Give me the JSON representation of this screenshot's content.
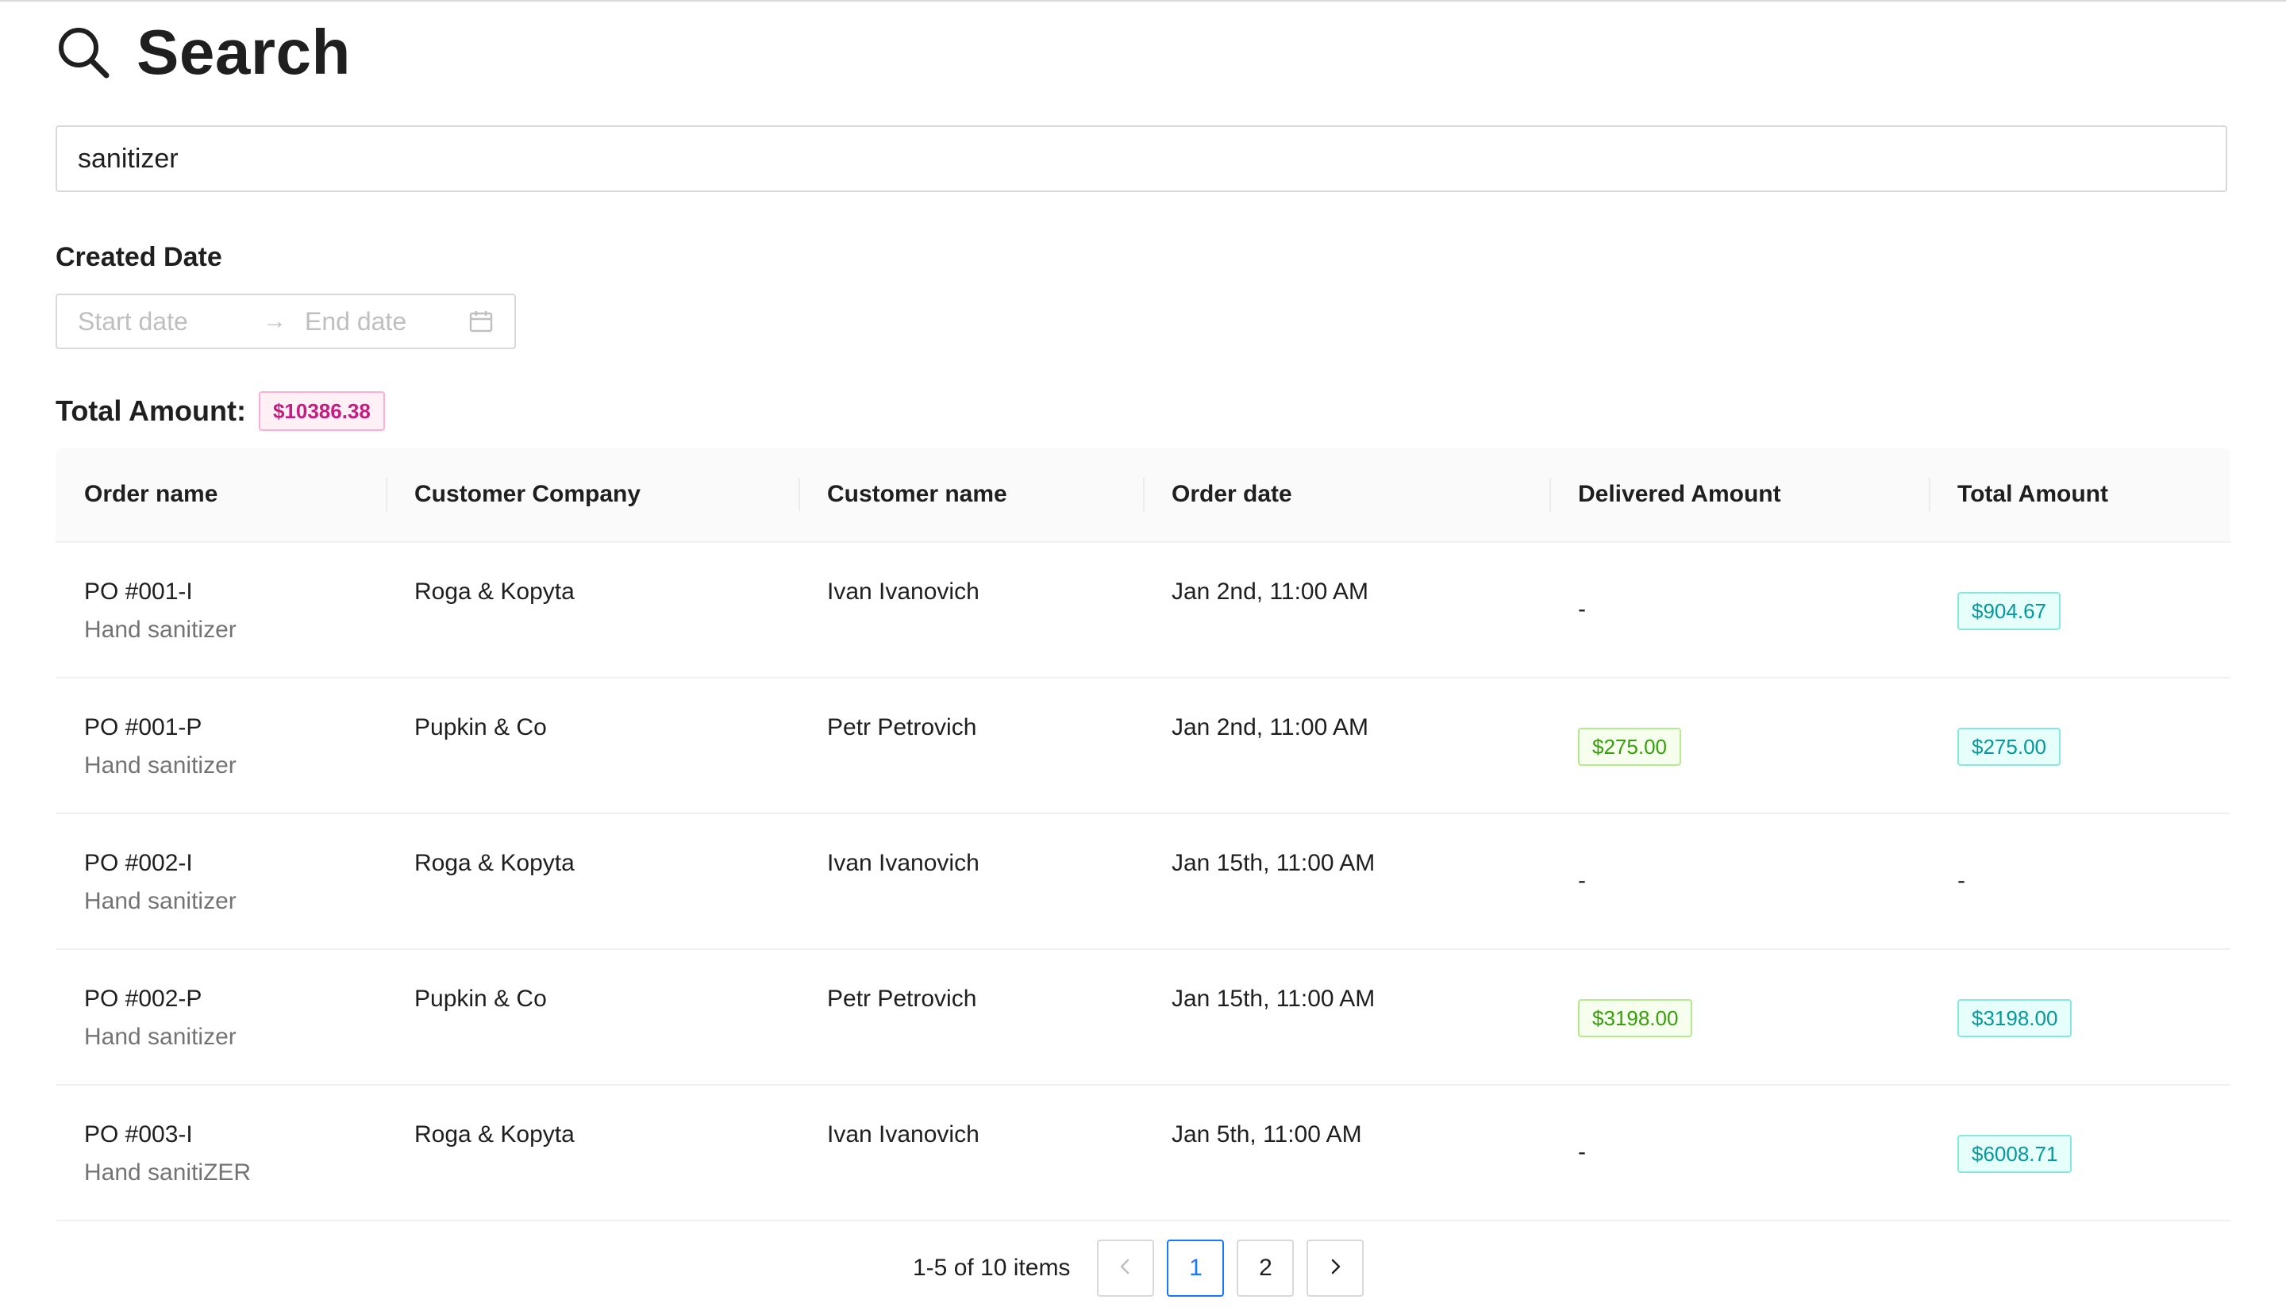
{
  "header": {
    "title": "Search",
    "icon": "search-icon"
  },
  "search": {
    "value": "sanitizer"
  },
  "filters": {
    "created_date_label": "Created Date",
    "start_placeholder": "Start date",
    "end_placeholder": "End date",
    "separator": "→",
    "calendar_icon": "calendar-icon"
  },
  "summary": {
    "total_label": "Total Amount:",
    "total_value": "$10386.38"
  },
  "table": {
    "columns": [
      "Order name",
      "Customer Company",
      "Customer name",
      "Order date",
      "Delivered Amount",
      "Total Amount"
    ],
    "rows": [
      {
        "order": "PO #001-I",
        "product": "Hand sanitizer",
        "company": "Roga & Kopyta",
        "customer": "Ivan Ivanovich",
        "date": "Jan 2nd, 11:00 AM",
        "delivered": "-",
        "total": "$904.67"
      },
      {
        "order": "PO #001-P",
        "product": "Hand sanitizer",
        "company": "Pupkin & Co",
        "customer": "Petr Petrovich",
        "date": "Jan 2nd, 11:00 AM",
        "delivered": "$275.00",
        "total": "$275.00"
      },
      {
        "order": "PO #002-I",
        "product": "Hand sanitizer",
        "company": "Roga & Kopyta",
        "customer": "Ivan Ivanovich",
        "date": "Jan 15th, 11:00 AM",
        "delivered": "-",
        "total": "-"
      },
      {
        "order": "PO #002-P",
        "product": "Hand sanitizer",
        "company": "Pupkin & Co",
        "customer": "Petr Petrovich",
        "date": "Jan 15th, 11:00 AM",
        "delivered": "$3198.00",
        "total": "$3198.00"
      },
      {
        "order": "PO #003-I",
        "product": "Hand sanitiZER",
        "company": "Roga & Kopyta",
        "customer": "Ivan Ivanovich",
        "date": "Jan 5th, 11:00 AM",
        "delivered": "-",
        "total": "$6008.71"
      }
    ]
  },
  "pagination": {
    "summary": "1-5 of 10 items",
    "pages": [
      "1",
      "2"
    ],
    "current": "1",
    "prev_icon": "chevron-left-icon",
    "next_icon": "chevron-right-icon"
  },
  "colors": {
    "total_tag": "#c41d7f",
    "delivered_tag": "#389e0d",
    "amount_tag": "#08979c",
    "accent": "#1677ff"
  }
}
